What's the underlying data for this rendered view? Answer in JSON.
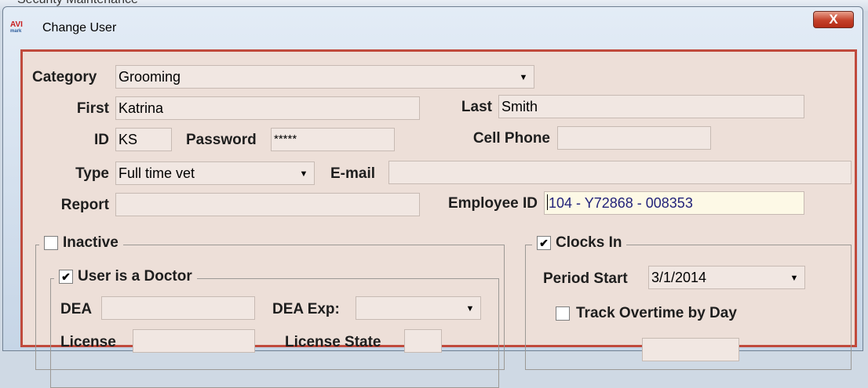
{
  "background_window": {
    "title": "Security Maintenance"
  },
  "window": {
    "title": "Change User",
    "icon_text": "AVI",
    "icon_subtext": "mark",
    "close_label": "X"
  },
  "form": {
    "category": {
      "label": "Category",
      "value": "Grooming"
    },
    "first": {
      "label": "First",
      "value": "Katrina"
    },
    "last": {
      "label": "Last",
      "value": "Smith"
    },
    "id": {
      "label": "ID",
      "value": "KS"
    },
    "password": {
      "label": "Password",
      "value": "*****"
    },
    "cell_phone": {
      "label": "Cell Phone",
      "value": ""
    },
    "type": {
      "label": "Type",
      "value": "Full time vet"
    },
    "email": {
      "label": "E-mail",
      "value": ""
    },
    "report": {
      "label": "Report",
      "value": ""
    },
    "employee_id": {
      "label": "Employee ID",
      "value": "104 - Y72868 - 008353"
    }
  },
  "inactive_group": {
    "label": "Inactive",
    "checked": false
  },
  "doctor_group": {
    "label": "User is a Doctor",
    "checked": true,
    "check_mark": "✔",
    "dea": {
      "label": "DEA",
      "value": ""
    },
    "dea_exp": {
      "label": "DEA Exp:",
      "value": ""
    },
    "license": {
      "label": "License",
      "value": ""
    },
    "license_state": {
      "label": "License State",
      "value": ""
    }
  },
  "clocks_group": {
    "label": "Clocks In",
    "checked": true,
    "check_mark": "✔",
    "period_start": {
      "label": "Period Start",
      "value": "3/1/2014"
    },
    "track_overtime": {
      "label": "Track Overtime by Day",
      "checked": false
    }
  },
  "icons": {
    "dropdown": "▼"
  }
}
